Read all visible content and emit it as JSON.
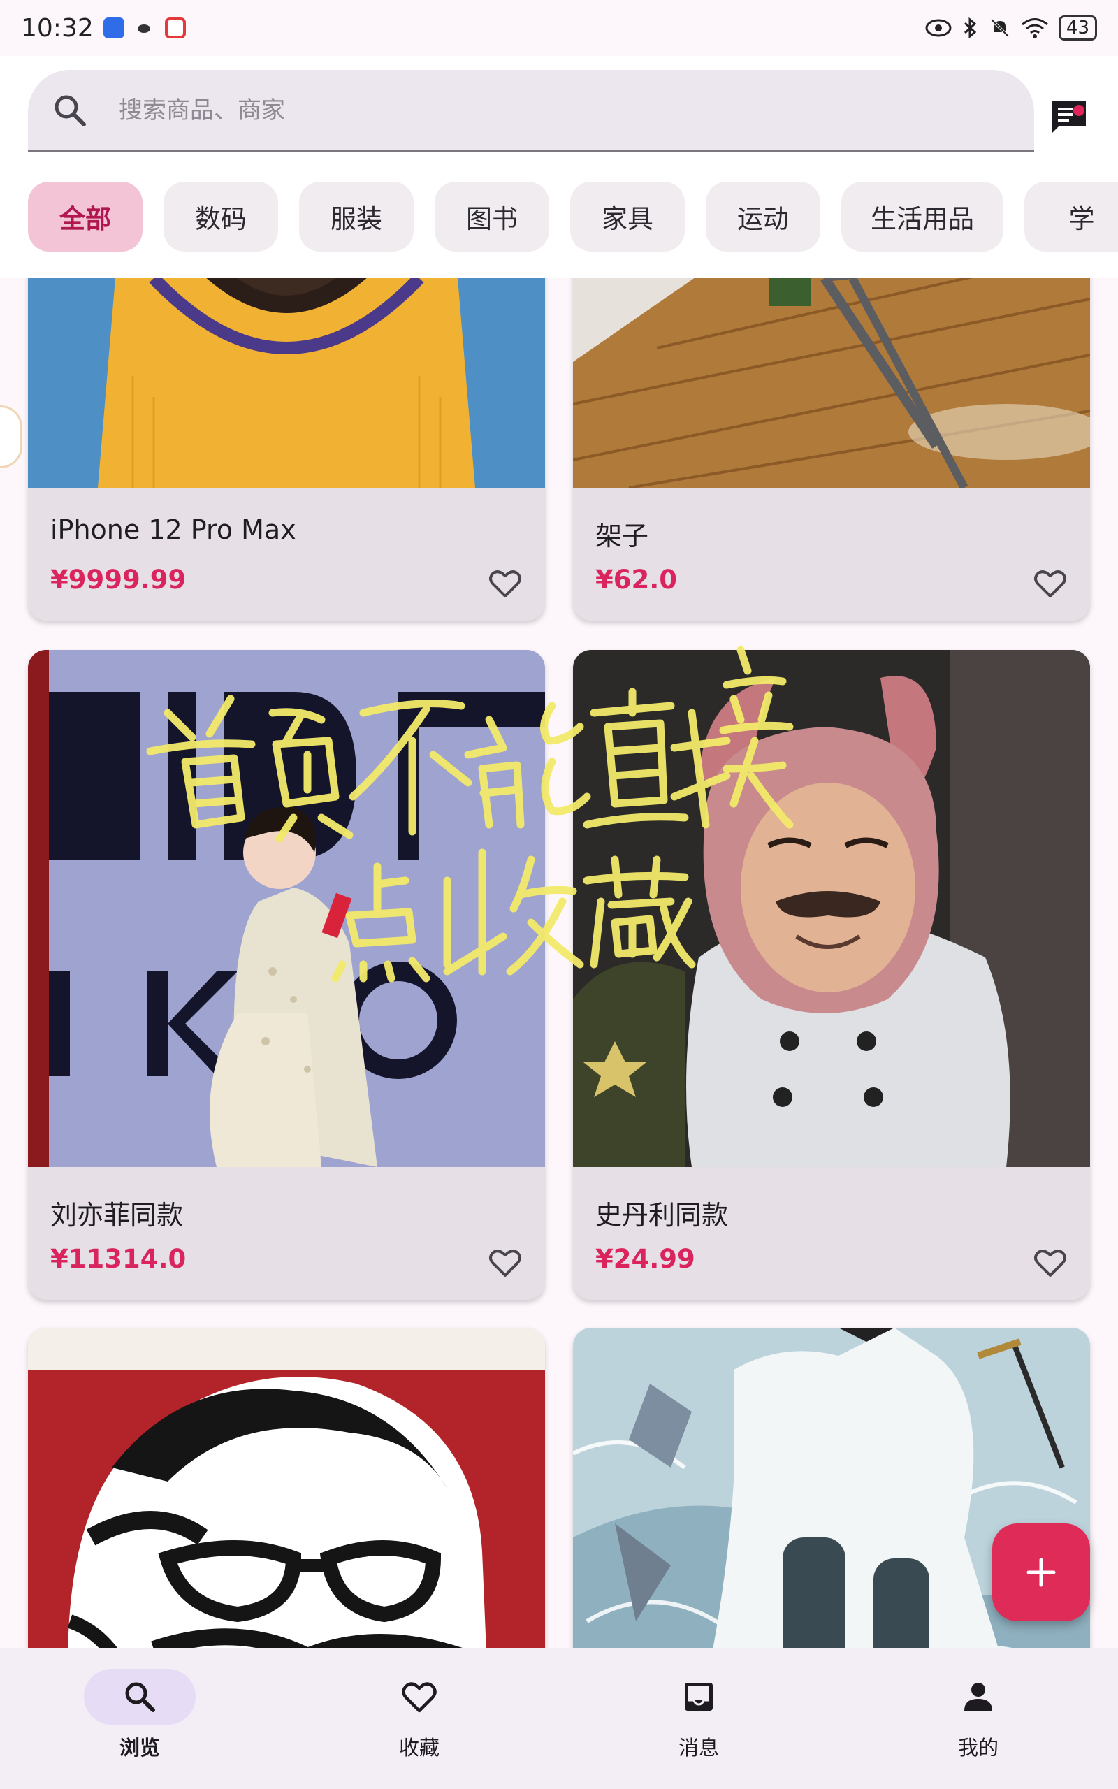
{
  "status_bar": {
    "time": "10:32",
    "battery": "43"
  },
  "search": {
    "placeholder": "搜索商品、商家"
  },
  "categories": [
    "全部",
    "数码",
    "服装",
    "图书",
    "家具",
    "运动",
    "生活用品",
    "学"
  ],
  "active_category": "全部",
  "products": [
    {
      "name": "iPhone 12 Pro Max",
      "price": "¥9999.99",
      "image": "person-in-yellow-jersey-photo"
    },
    {
      "name": "架子",
      "price": "¥62.0",
      "image": "chair-on-wood-floor-photo"
    },
    {
      "name": "刘亦菲同款",
      "price": "¥11314.0",
      "image": "woman-in-white-dress-photo"
    },
    {
      "name": "史丹利同款",
      "price": "¥24.99",
      "image": "man-in-bunny-hood-photo"
    },
    {
      "name": "",
      "price": "",
      "image": "kfc-colonel-logo-image"
    },
    {
      "name": "",
      "price": "",
      "image": "anime-warrior-illustration"
    }
  ],
  "annotation": "首页不能直接点收藏",
  "bottom_nav": [
    {
      "label": "浏览",
      "icon": "search-icon",
      "active": true
    },
    {
      "label": "收藏",
      "icon": "heart-icon",
      "active": false
    },
    {
      "label": "消息",
      "icon": "inbox-icon",
      "active": false
    },
    {
      "label": "我的",
      "icon": "person-icon",
      "active": false
    }
  ],
  "colors": {
    "accent": "#df2b58",
    "price": "#d9245d",
    "active_chip_bg": "#f2c4d6",
    "nav_active_pill": "#e6dcf5"
  }
}
